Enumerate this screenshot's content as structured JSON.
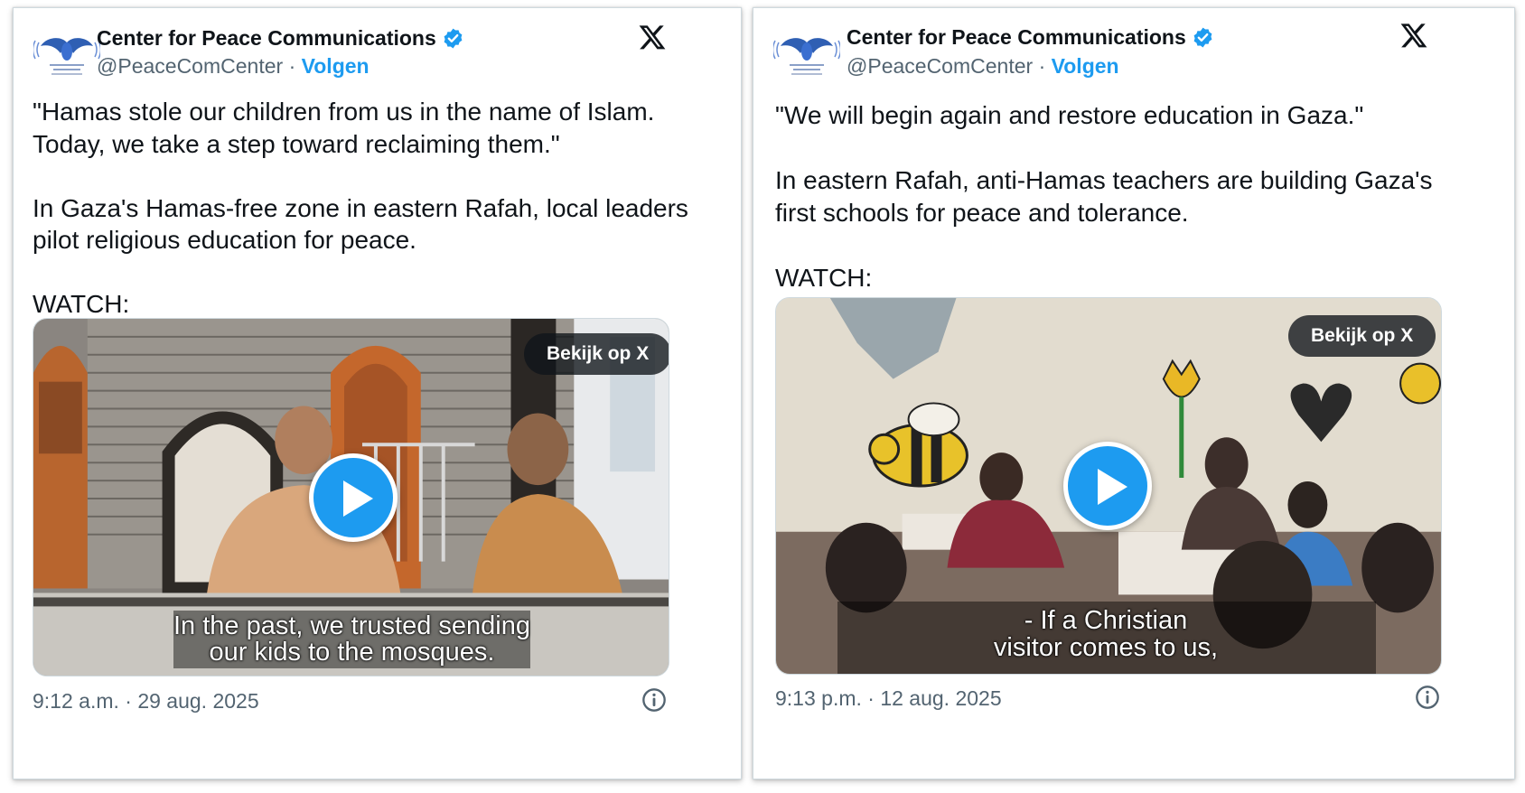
{
  "colors": {
    "accent": "#1d9bf0",
    "text": "#0f1419",
    "muted": "#536471",
    "border": "#cfd9de"
  },
  "tweets": [
    {
      "author": {
        "name": "Center for Peace Communications",
        "handle": "@PeaceComCenter",
        "separator": "·",
        "follow_label": "Volgen",
        "verified": true,
        "avatar_icon": "dove-logo-icon"
      },
      "text": "\"Hamas stole our children from us in the name of Islam.\nToday, we take a step toward reclaiming them.\"\n\nIn Gaza's Hamas-free zone in eastern Rafah, local leaders\npilot religious education for peace.\n\nWATCH:",
      "media": {
        "watch_label": "Bekijk op X",
        "subtitle": "In the past, we trusted sending\nour kids to the mosques.",
        "play_icon": "play-icon"
      },
      "timestamp": "9:12 a.m. · 29 aug. 2025",
      "info_icon": "info-icon",
      "brand_icon": "x-logo-icon"
    },
    {
      "author": {
        "name": "Center for Peace Communications",
        "handle": "@PeaceComCenter",
        "separator": "·",
        "follow_label": "Volgen",
        "verified": true,
        "avatar_icon": "dove-logo-icon"
      },
      "text": "\"We will begin again and restore education in Gaza.\"\n\nIn eastern Rafah, anti-Hamas teachers are building Gaza's\nfirst schools for peace and tolerance.\n\nWATCH:",
      "media": {
        "watch_label": "Bekijk op X",
        "subtitle": "- If a Christian\nvisitor comes to us,",
        "play_icon": "play-icon"
      },
      "timestamp": "9:13 p.m. · 12 aug. 2025",
      "info_icon": "info-icon",
      "brand_icon": "x-logo-icon"
    }
  ]
}
